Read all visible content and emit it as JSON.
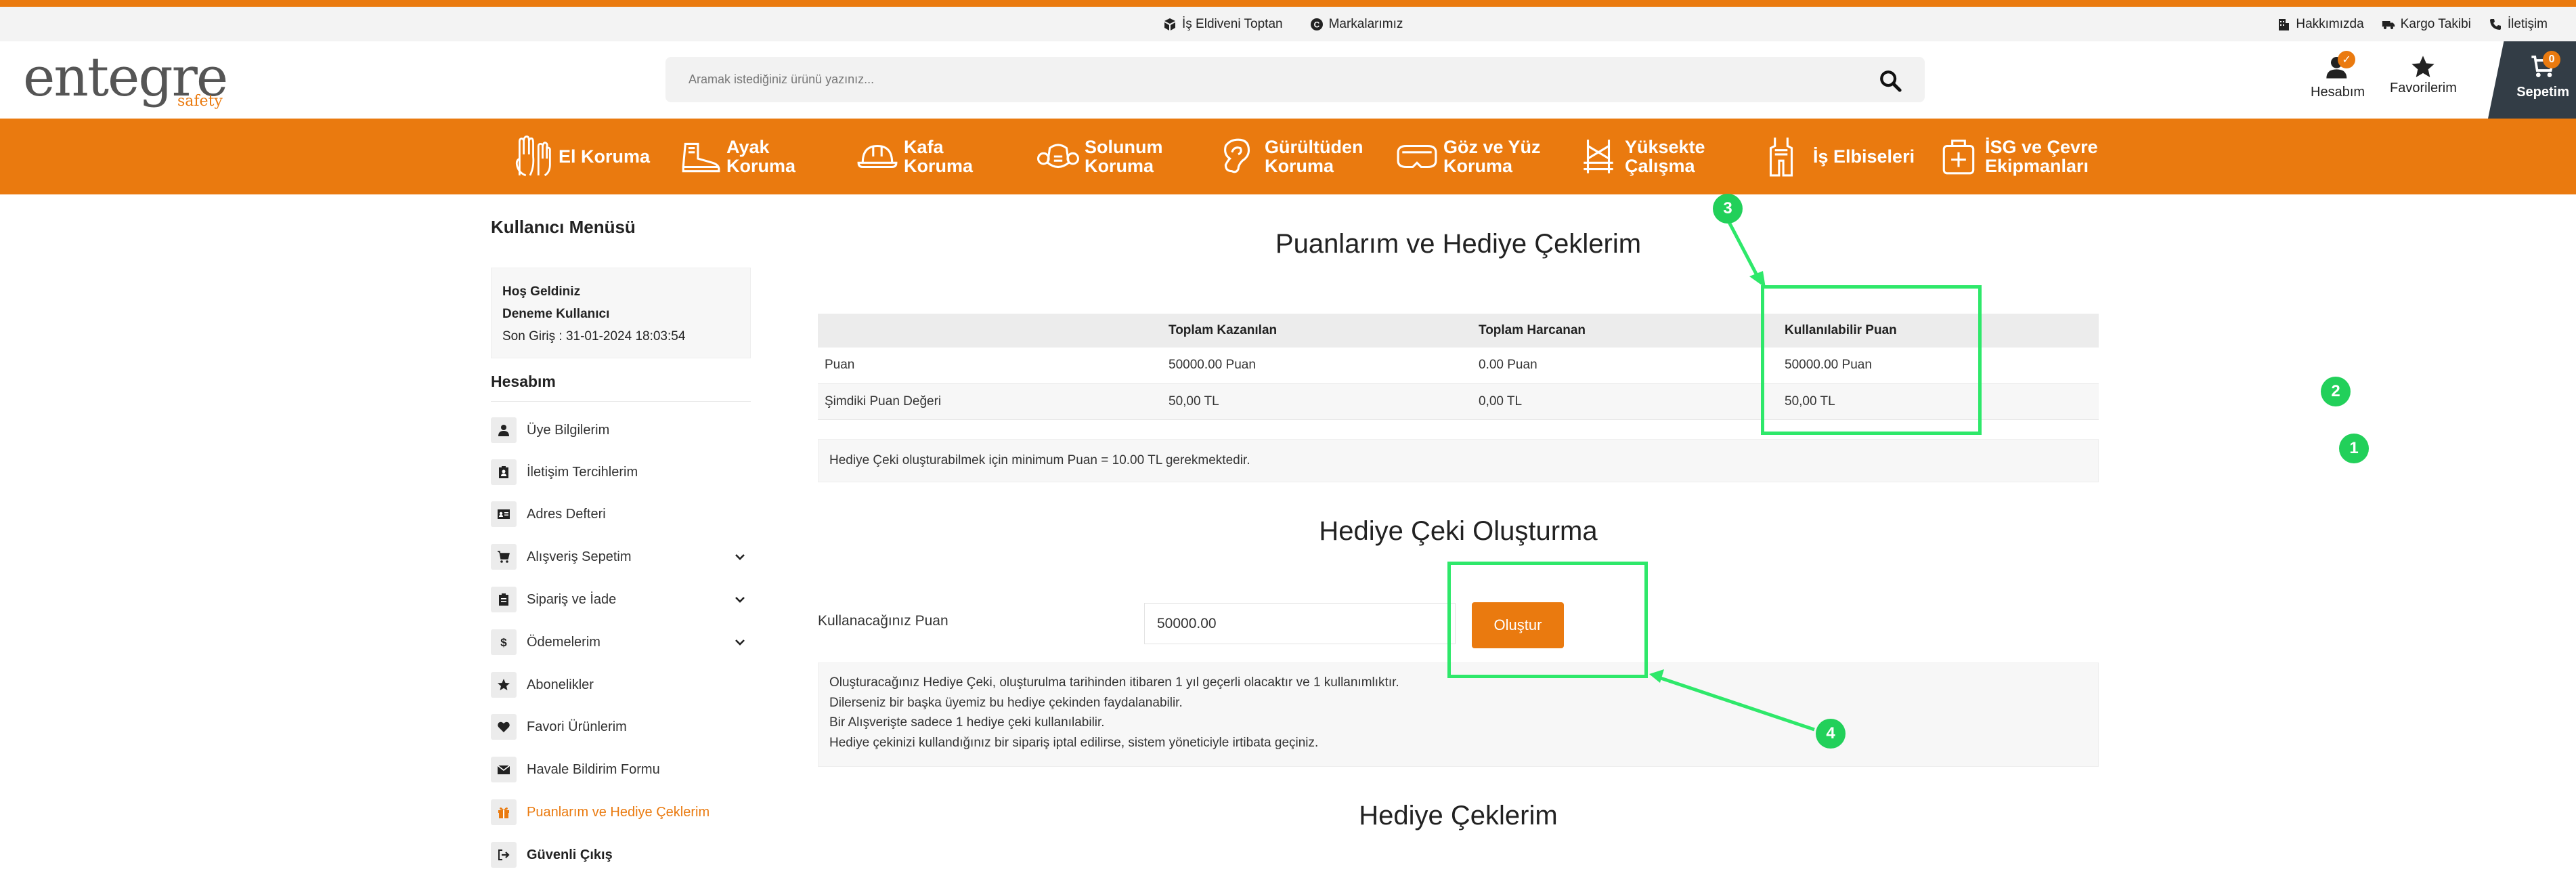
{
  "topbar": {
    "center": [
      {
        "label": "İş Eldiveni Toptan",
        "icon": "box-icon"
      },
      {
        "label": "Markalarımız",
        "icon": "brand-icon"
      }
    ],
    "right": [
      {
        "label": "Hakkımızda",
        "icon": "building-icon"
      },
      {
        "label": "Kargo Takibi",
        "icon": "truck-icon"
      },
      {
        "label": "İletişim",
        "icon": "phone-icon"
      }
    ]
  },
  "header": {
    "logo_word": "entegre",
    "logo_sub": "safety",
    "search_placeholder": "Aramak istediğiniz ürünü yazınız...",
    "account_label": "Hesabım",
    "favorites_label": "Favorilerim",
    "cart_label": "Sepetim",
    "cart_count": "0"
  },
  "nav": [
    {
      "label": "El Koruma",
      "icon": "glove-icon"
    },
    {
      "label": "Ayak Koruma",
      "icon": "boot-icon"
    },
    {
      "label": "Kafa Koruma",
      "icon": "helmet-icon"
    },
    {
      "label": "Solunum Koruma",
      "icon": "respirator-icon"
    },
    {
      "label": "Gürültüden Koruma",
      "icon": "ear-icon"
    },
    {
      "label": "Göz ve Yüz Koruma",
      "icon": "goggles-icon"
    },
    {
      "label": "Yüksekte Çalışma",
      "icon": "harness-icon"
    },
    {
      "label": "İş Elbiseleri",
      "icon": "coverall-icon"
    },
    {
      "label": "İSG ve Çevre Ekipmanları",
      "icon": "kit-icon"
    }
  ],
  "sidebar": {
    "title": "Kullanıcı Menüsü",
    "welcome": "Hoş Geldiniz",
    "username": "Deneme Kullanıcı",
    "last_login": "Son Giriş : 31-01-2024 18:03:54",
    "section": "Hesabım",
    "items": [
      {
        "label": "Üye Bilgilerim",
        "icon": "user-icon"
      },
      {
        "label": "İletişim Tercihlerim",
        "icon": "contact-icon"
      },
      {
        "label": "Adres Defteri",
        "icon": "address-card-icon"
      },
      {
        "label": "Alışveriş Sepetim",
        "icon": "cart-icon"
      },
      {
        "label": "Sipariş ve İade",
        "icon": "clipboard-icon"
      },
      {
        "label": "Ödemelerim",
        "icon": "dollar-icon"
      },
      {
        "label": "Abonelikler",
        "icon": "star-icon"
      },
      {
        "label": "Favori Ürünlerim",
        "icon": "heart-icon"
      },
      {
        "label": "Havale Bildirim Formu",
        "icon": "envelope-icon"
      },
      {
        "label": "Puanlarım ve Hediye Çeklerim",
        "icon": "gift-icon"
      },
      {
        "label": "Güvenli Çıkış",
        "icon": "logout-icon"
      }
    ]
  },
  "content": {
    "title": "Puanlarım ve Hediye Çeklerim",
    "table": {
      "headers": [
        "",
        "Toplam Kazanılan",
        "Toplam Harcanan",
        "Kullanılabilir Puan"
      ],
      "rows": [
        [
          "Puan",
          "50000.00 Puan",
          "0.00 Puan",
          "50000.00 Puan"
        ],
        [
          "Şimdiki Puan Değeri",
          "50,00 TL",
          "0,00 TL",
          "50,00 TL"
        ]
      ]
    },
    "min_info": "Hediye Çeki oluşturabilmek için minimum Puan = 10.00 TL gerekmektedir.",
    "create_title": "Hediye Çeki Oluşturma",
    "points_label": "Kullanacağınız Puan",
    "points_value": "50000.00",
    "create_button": "Oluştur",
    "rules": [
      "Oluşturacağınız Hediye Çeki, oluşturulma tarihinden itibaren 1 yıl geçerli olacaktır ve 1 kullanımlıktır.",
      "Dilerseniz bir başka üyemiz bu hediye çekinden faydalanabilir.",
      "Bir Alışverişte sadece 1 hediye çeki kullanılabilir.",
      "Hediye çekinizi kullandığınız bir sipariş iptal edilirse, sistem yöneticiyle irtibata geçiniz."
    ],
    "vouchers_title": "Hediye Çeklerim"
  },
  "annotations": {
    "markers": [
      "1",
      "2",
      "3",
      "4"
    ],
    "color": "#2ee86a"
  },
  "colors": {
    "accent": "#ea7a0f",
    "dark": "#333d46"
  }
}
